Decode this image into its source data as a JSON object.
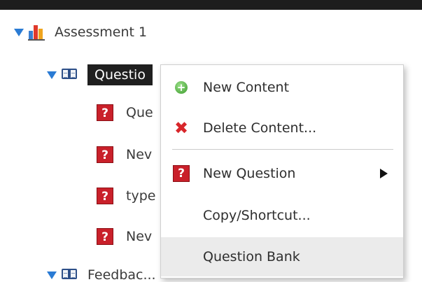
{
  "tree": {
    "root": {
      "label": "Assessment 1",
      "icon": "bar-chart-icon"
    },
    "section": {
      "label": "Questio",
      "icon": "book-icon"
    },
    "items": [
      {
        "label": "Que",
        "icon": "question-icon",
        "glyph": "?"
      },
      {
        "label": "Nev",
        "icon": "question-icon",
        "glyph": "?"
      },
      {
        "label": "type",
        "icon": "question-icon",
        "glyph": "?"
      },
      {
        "label": "Nev",
        "icon": "question-icon",
        "glyph": "?"
      }
    ],
    "feedback": {
      "label": "Feedbac...",
      "icon": "book-icon"
    }
  },
  "context_menu": {
    "items": [
      {
        "label": "New Content",
        "icon": "plus-circle-icon"
      },
      {
        "label": "Delete Content...",
        "icon": "red-x-icon",
        "glyph": "✖"
      },
      {
        "label": "New Question",
        "icon": "question-icon",
        "glyph": "?",
        "submenu": true
      },
      {
        "label": "Copy/Shortcut..."
      },
      {
        "label": "Question Bank",
        "highlighted": true
      }
    ]
  },
  "colors": {
    "expander": "#2a7bd4",
    "selection_bg": "#1f1f1f",
    "question_red": "#c9202a",
    "menu_hover": "#ebebeb"
  }
}
